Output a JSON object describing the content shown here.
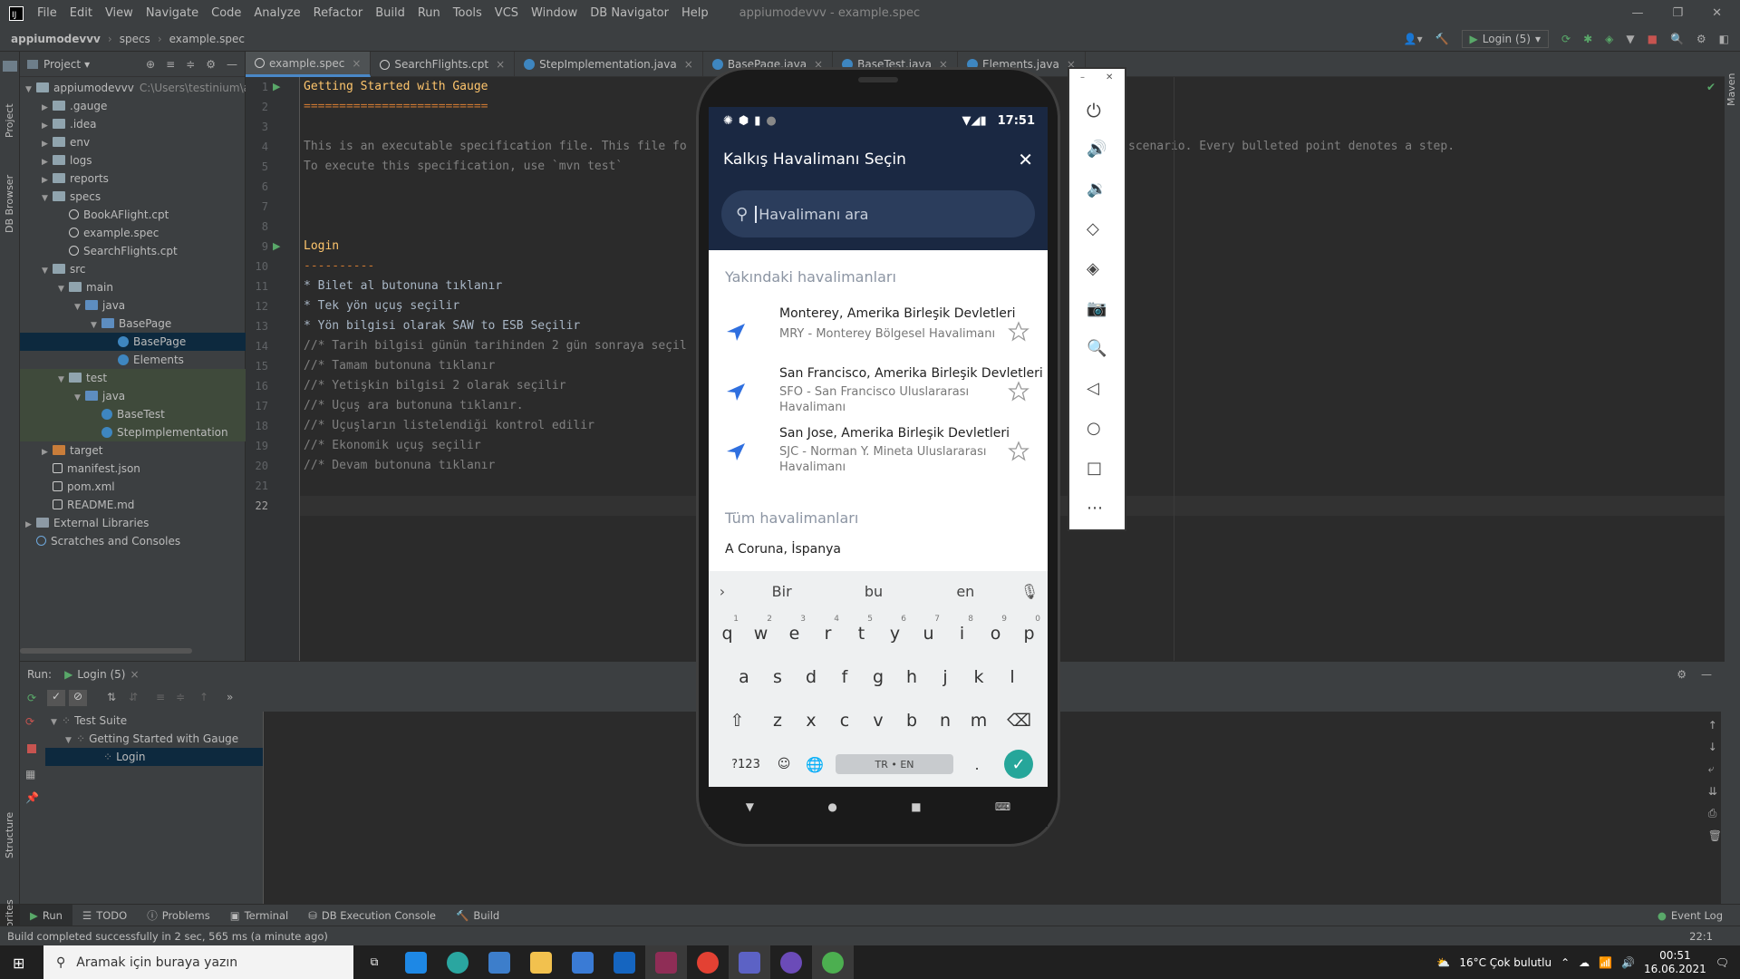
{
  "menubar": {
    "items": [
      "File",
      "Edit",
      "View",
      "Navigate",
      "Code",
      "Analyze",
      "Refactor",
      "Build",
      "Run",
      "Tools",
      "VCS",
      "Window",
      "DB Navigator",
      "Help"
    ],
    "title": "appiumodevvv - example.spec"
  },
  "toolbar": {
    "breadcrumb": [
      "appiumodevvv",
      "specs",
      "example.spec"
    ],
    "run_config": "Login (5)"
  },
  "left_strip": {
    "project": "Project",
    "db_browser": "DB Browser",
    "structure": "Structure",
    "favorites": "Favorites"
  },
  "right_strip": {
    "maven": "Maven"
  },
  "project": {
    "header": "Project",
    "tree": [
      {
        "label": "appiumodevvv",
        "extra": "C:\\Users\\testinium\\ap",
        "icon": "folder"
      },
      {
        "label": ".gauge",
        "icon": "folder"
      },
      {
        "label": ".idea",
        "icon": "folder"
      },
      {
        "label": "env",
        "icon": "folder"
      },
      {
        "label": "logs",
        "icon": "folder"
      },
      {
        "label": "reports",
        "icon": "folder"
      },
      {
        "label": "specs",
        "icon": "folder"
      },
      {
        "label": "BookAFlight.cpt",
        "icon": "spec"
      },
      {
        "label": "example.spec",
        "icon": "spec"
      },
      {
        "label": "SearchFlights.cpt",
        "icon": "spec"
      },
      {
        "label": "src",
        "icon": "folder"
      },
      {
        "label": "main",
        "icon": "folder"
      },
      {
        "label": "java",
        "icon": "folder-blue"
      },
      {
        "label": "BasePage",
        "icon": "folder-blue"
      },
      {
        "label": "BasePage",
        "icon": "class"
      },
      {
        "label": "Elements",
        "icon": "class"
      },
      {
        "label": "test",
        "icon": "folder"
      },
      {
        "label": "java",
        "icon": "folder-blue"
      },
      {
        "label": "BaseTest",
        "icon": "class"
      },
      {
        "label": "StepImplementation",
        "icon": "class"
      },
      {
        "label": "target",
        "icon": "folder-orange"
      },
      {
        "label": "manifest.json",
        "icon": "file"
      },
      {
        "label": "pom.xml",
        "icon": "file"
      },
      {
        "label": "README.md",
        "icon": "file"
      },
      {
        "label": "External Libraries",
        "icon": "lib"
      },
      {
        "label": "Scratches and Consoles",
        "icon": "scratch"
      }
    ]
  },
  "tabs": [
    "example.spec",
    "SearchFlights.cpt",
    "StepImplementation.java",
    "BasePage.java",
    "BaseTest.java",
    "Elements.java"
  ],
  "editor": {
    "line_numbers": [
      "1",
      "2",
      "3",
      "4",
      "5",
      "6",
      "7",
      "8",
      "9",
      "10",
      "11",
      "12",
      "13",
      "14",
      "15",
      "16",
      "17",
      "18",
      "19",
      "20",
      "21",
      "22"
    ],
    "lines": [
      "Getting Started with Gauge",
      "==========================",
      "",
      "This is an executable specification file. This file fo",
      "To execute this specification, use `mvn test`",
      "",
      "",
      "",
      "Login",
      "----------",
      "* Bilet al butonuna tıklanır",
      "* Tek yön uçuş seçilir",
      "* Yön bilgisi olarak SAW to ESB Seçilir",
      "//* Tarih bilgisi günün tarihinden 2 gün sonraya seçil",
      "//* Tamam butonuna tıklanır",
      "//* Yetişkin bilgisi 2 olarak seçilir",
      "//* Uçuş ara butonuna tıklanır.",
      "//* Uçuşların listelendiği kontrol edilir",
      "//* Ekonomik uçuş seçilir",
      "//* Devam butonuna tıklanır",
      "",
      ""
    ],
    "overflow_text": "scenario. Every bulleted point denotes a step."
  },
  "run": {
    "label": "Run:",
    "config_tab": "Login (5)",
    "tree": [
      {
        "label": "Test Suite"
      },
      {
        "label": "Getting Started with Gauge"
      },
      {
        "label": "Login"
      }
    ]
  },
  "bottom_tabs": [
    "Run",
    "TODO",
    "Problems",
    "Terminal",
    "DB Execution Console",
    "Build"
  ],
  "event_log": "Event Log",
  "status": {
    "message": "Build completed successfully in 2 sec, 565 ms (a minute ago)",
    "position": "22:1"
  },
  "phone": {
    "time": "17:51",
    "title": "Kalkış Havalimanı Seçin",
    "search_placeholder": "Havalimanı ara",
    "nearby_header": "Yakındaki havalimanları",
    "airports": [
      {
        "title": "Monterey, Amerika Birleşik Devletleri",
        "sub": "MRY - Monterey Bölgesel Havalimanı"
      },
      {
        "title": "San Francisco, Amerika Birleşik Devletleri",
        "sub": "SFO - San Francisco Uluslararası Havalimanı"
      },
      {
        "title": "San Jose, Amerika Birleşik Devletleri",
        "sub": "SJC - Norman Y. Mineta Uluslararası Havalimanı"
      }
    ],
    "all_header": "Tüm havalimanları",
    "all_first": "A Coruna, İspanya",
    "keyboard": {
      "suggestions": [
        "Bir",
        "bu",
        "en"
      ],
      "row1": [
        "q",
        "w",
        "e",
        "r",
        "t",
        "y",
        "u",
        "i",
        "o",
        "p"
      ],
      "row1_nums": [
        "1",
        "2",
        "3",
        "4",
        "5",
        "6",
        "7",
        "8",
        "9",
        "0"
      ],
      "row2": [
        "a",
        "s",
        "d",
        "f",
        "g",
        "h",
        "j",
        "k",
        "l"
      ],
      "row3": [
        "z",
        "x",
        "c",
        "v",
        "b",
        "n",
        "m"
      ],
      "sym": "?123",
      "lang": "TR • EN",
      "dot": "."
    }
  },
  "taskbar": {
    "search_placeholder": "Aramak için buraya yazın",
    "weather": "16°C  Çok bulutlu",
    "time": "00:51",
    "date": "16.06.2021"
  },
  "colors": {
    "ide_bg": "#2b2b2b",
    "panel": "#3c3f41",
    "accent": "#4a88c7",
    "app_header": "#1a2842",
    "keyboard_confirm": "#26a69a"
  }
}
